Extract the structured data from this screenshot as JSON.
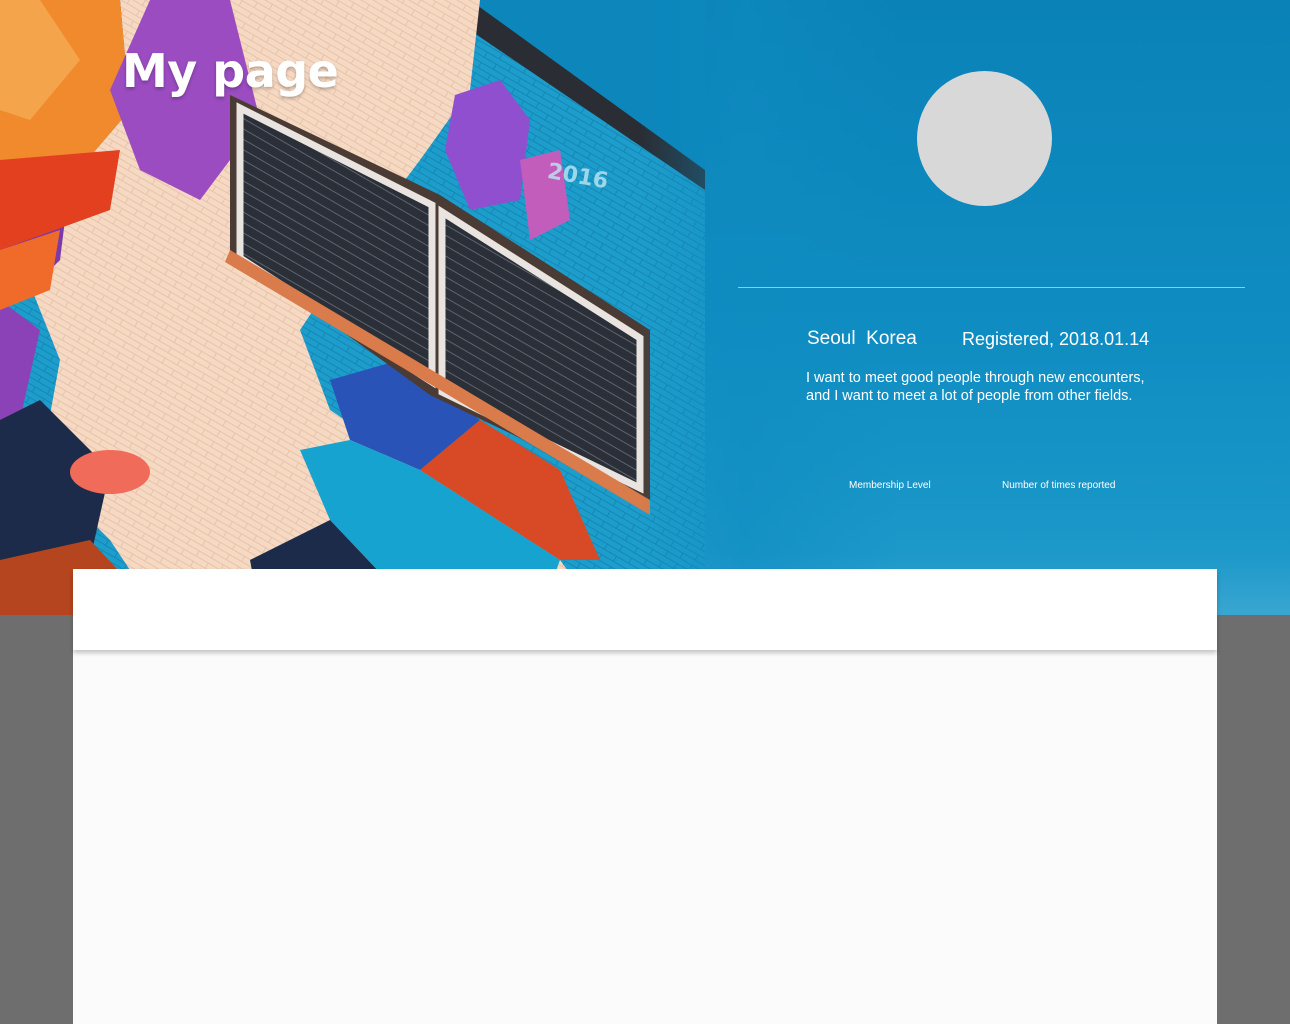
{
  "page": {
    "title": "My page"
  },
  "profile": {
    "location": "Seoul  Korea",
    "registered": "Registered, 2018.01.14",
    "bio_lines": [
      "I want to meet good people through new encounters,",
      "and I want to meet a lot of people from other fields."
    ],
    "stats": {
      "membership_level_label": "Membership Level",
      "reported_label": "Number of times reported"
    }
  },
  "colors": {
    "hero_blue": "#0a82b7",
    "avatar_placeholder": "#d8d8d8",
    "content_background": "#fbfbfb",
    "page_background": "#6e6e6e"
  }
}
